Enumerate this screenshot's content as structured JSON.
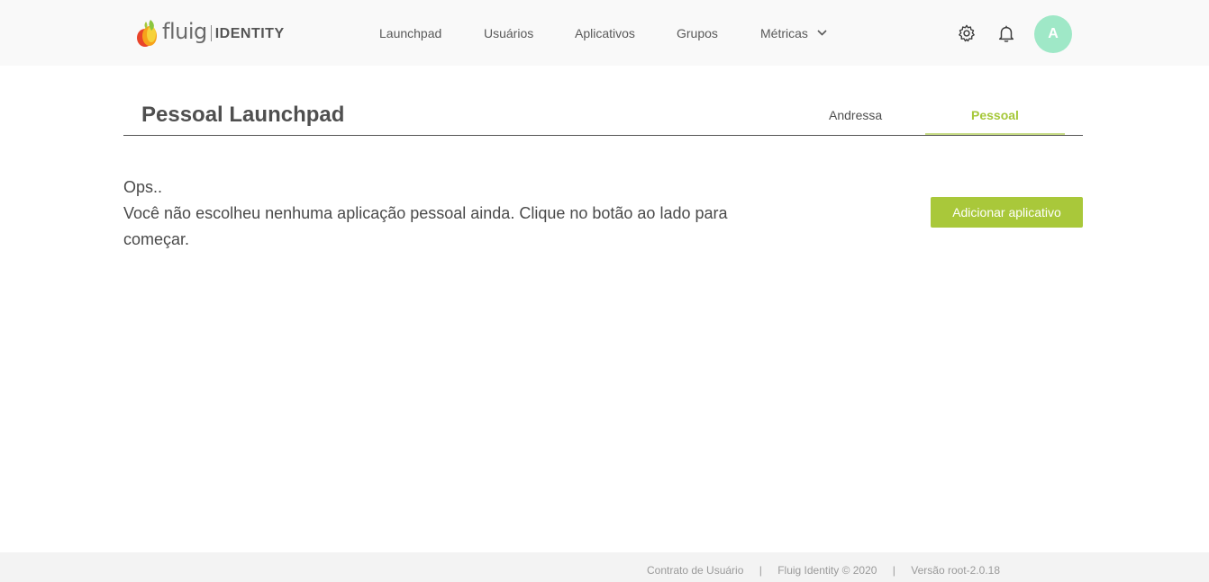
{
  "brand": {
    "word": "fluig",
    "product": "IDENTITY"
  },
  "nav": {
    "items": [
      {
        "label": "Launchpad"
      },
      {
        "label": "Usuários"
      },
      {
        "label": "Aplicativos"
      },
      {
        "label": "Grupos"
      },
      {
        "label": "Métricas"
      }
    ],
    "icons": [
      "gear-icon",
      "bell-icon",
      "chevron-down-icon"
    ]
  },
  "user": {
    "avatar_initial": "A",
    "avatar_color": "#9fe8c7"
  },
  "page": {
    "title": "Pessoal Launchpad",
    "tabs": [
      {
        "label": "Andressa",
        "active": false
      },
      {
        "label": "Pessoal",
        "active": true
      }
    ]
  },
  "empty_state": {
    "line1": "Ops..",
    "line2": "Você não escolheu nenhuma aplicação pessoal ainda. Clique no botão ao lado para começar."
  },
  "actions": {
    "add_app_label": "Adicionar aplicativo"
  },
  "footer": {
    "contract": "Contrato de Usuário",
    "copyright": "Fluig Identity © 2020",
    "version": "Versão root-2.0.18",
    "separator": "|"
  },
  "colors": {
    "accent": "#a9c83a",
    "topbar_bg": "#f9f9f9",
    "footer_bg": "#f3f3f3"
  }
}
